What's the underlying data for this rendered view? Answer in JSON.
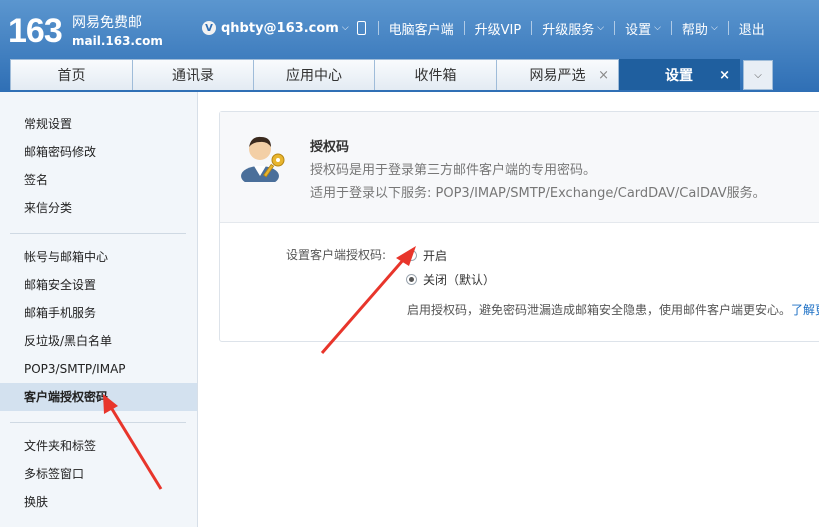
{
  "header": {
    "logo_number": "163",
    "logo_text": "网易免费邮",
    "logo_domain": "mail.163.com",
    "account": "qhbty@163.com",
    "vip_badge": "V",
    "links": [
      "电脑客户端",
      "升级VIP",
      "升级服务",
      "设置",
      "帮助",
      "退出"
    ]
  },
  "tabs": [
    {
      "label": "首页",
      "closable": false
    },
    {
      "label": "通讯录",
      "closable": false
    },
    {
      "label": "应用中心",
      "closable": false
    },
    {
      "label": "收件箱",
      "closable": false
    },
    {
      "label": "网易严选",
      "closable": true
    },
    {
      "label": "设置",
      "closable": true,
      "active": true
    }
  ],
  "close_glyph": "×",
  "sidebar": {
    "items": [
      "常规设置",
      "邮箱密码修改",
      "签名",
      "来信分类",
      "帐号与邮箱中心",
      "邮箱安全设置",
      "邮箱手机服务",
      "反垃圾/黑白名单",
      "POP3/SMTP/IMAP",
      "客户端授权密码",
      "文件夹和标签",
      "多标签窗口",
      "换肤"
    ],
    "selected": "客户端授权密码"
  },
  "panel": {
    "title": "授权码",
    "desc1": "授权码是用于登录第三方邮件客户端的专用密码。",
    "desc2": "适用于登录以下服务: POP3/IMAP/SMTP/Exchange/CardDAV/CalDAV服务。",
    "setting_label": "设置客户端授权码:",
    "option_on": "开启",
    "option_off": "关闭（默认）",
    "selected_option": "关闭",
    "hint": "启用授权码，避免密码泄漏造成邮箱安全隐患，使用邮件客户端更安心。",
    "hint_link": "了解更多"
  },
  "colors": {
    "header_top": "#5b96cf",
    "header_bottom": "#2f6fb5",
    "active_tab": "#1f5f9f",
    "annotation_arrow": "#e8352b",
    "link": "#1a6ec4"
  }
}
